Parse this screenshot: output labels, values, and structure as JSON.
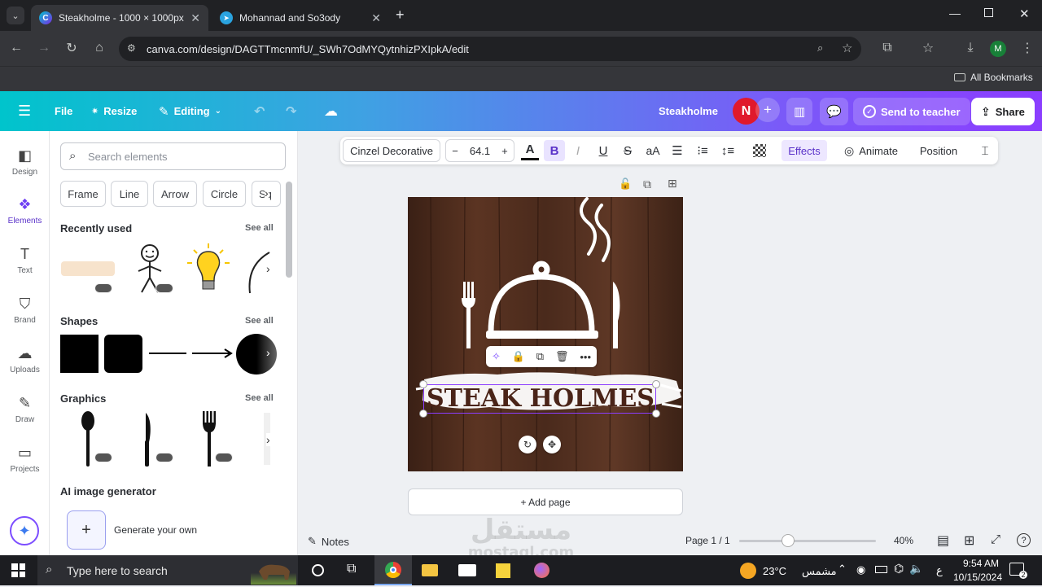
{
  "browser": {
    "tabs": [
      {
        "title": "Steakholme - 1000 × 1000px - C",
        "active": true
      },
      {
        "title": "Mohannad and So3ody",
        "active": false
      }
    ],
    "url": "canva.com/design/DAGTTmcnmfU/_SWh7OdMYQytnhizPXIpkA/edit",
    "bookmarks_label": "All Bookmarks",
    "profile_initial": "M"
  },
  "canva_header": {
    "menu_label": "File",
    "resize_label": "Resize",
    "editing_label": "Editing",
    "design_title": "Steakholme",
    "avatar_initial": "N",
    "send_to_teacher": "Send to teacher",
    "share": "Share"
  },
  "rail": [
    {
      "label": "Design",
      "icon": "design-icon"
    },
    {
      "label": "Elements",
      "icon": "elements-icon"
    },
    {
      "label": "Text",
      "icon": "text-icon"
    },
    {
      "label": "Brand",
      "icon": "brand-icon"
    },
    {
      "label": "Uploads",
      "icon": "uploads-icon"
    },
    {
      "label": "Draw",
      "icon": "draw-icon"
    },
    {
      "label": "Projects",
      "icon": "projects-icon"
    }
  ],
  "panel": {
    "search_placeholder": "Search elements",
    "chips": [
      "Frame",
      "Line",
      "Arrow",
      "Circle",
      "Sq"
    ],
    "recently_used": "Recently used",
    "shapes": "Shapes",
    "graphics": "Graphics",
    "see_all": "See all",
    "ai_title": "AI image generator",
    "generate_label": "Generate your own"
  },
  "text_toolbar": {
    "font": "Cinzel Decorative",
    "font_size": "64.1",
    "effects": "Effects",
    "animate": "Animate",
    "position": "Position"
  },
  "design": {
    "headline": "STEAK HOLMES"
  },
  "add_page": "+ Add page",
  "footer": {
    "notes": "Notes",
    "page_indicator": "Page 1 / 1",
    "zoom": "40%",
    "zoom_fraction": 0.4
  },
  "watermark": {
    "arabic": "مستقل",
    "latin": "mostaql.com"
  },
  "taskbar": {
    "search_placeholder": "Type here to search",
    "weather": "23°C",
    "weather_desc": "مشمس",
    "time": "9:54 AM",
    "date": "10/15/2024",
    "lang": "ع",
    "notification_count": "2"
  },
  "colors": {
    "canva_gradient_start": "#00c4cc",
    "canva_gradient_end": "#8b3dff",
    "avatar_red": "#e0192c",
    "wood": "#4a2a1c",
    "headline_text": "#4a2418",
    "selection_purple": "#8b3dff"
  }
}
